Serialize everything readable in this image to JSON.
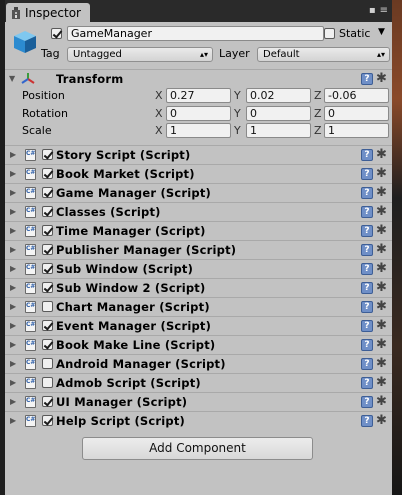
{
  "tab": {
    "title": "Inspector"
  },
  "header": {
    "object_name": "GameManager",
    "active": true,
    "static_label": "Static",
    "static_checked": false,
    "tag_label": "Tag",
    "tag_value": "Untagged",
    "layer_label": "Layer",
    "layer_value": "Default"
  },
  "transform": {
    "title": "Transform",
    "rows": [
      {
        "label": "Position",
        "x": "0.27",
        "y": "0.02",
        "z": "-0.06"
      },
      {
        "label": "Rotation",
        "x": "0",
        "y": "0",
        "z": "0"
      },
      {
        "label": "Scale",
        "x": "1",
        "y": "1",
        "z": "1"
      }
    ],
    "axes": {
      "x": "X",
      "y": "Y",
      "z": "Z"
    }
  },
  "components": [
    {
      "name": "Story Script (Script)",
      "enabled": true
    },
    {
      "name": "Book Market (Script)",
      "enabled": true
    },
    {
      "name": "Game Manager (Script)",
      "enabled": true
    },
    {
      "name": "Classes (Script)",
      "enabled": true
    },
    {
      "name": "Time Manager (Script)",
      "enabled": true
    },
    {
      "name": "Publisher Manager (Script)",
      "enabled": true
    },
    {
      "name": "Sub Window (Script)",
      "enabled": true
    },
    {
      "name": "Sub Window 2 (Script)",
      "enabled": true
    },
    {
      "name": "Chart Manager (Script)",
      "enabled": false
    },
    {
      "name": "Event Manager (Script)",
      "enabled": true
    },
    {
      "name": "Book Make Line (Script)",
      "enabled": true
    },
    {
      "name": "Android Manager (Script)",
      "enabled": false
    },
    {
      "name": "Admob Script (Script)",
      "enabled": false
    },
    {
      "name": "UI Manager (Script)",
      "enabled": true
    },
    {
      "name": "Help Script (Script)",
      "enabled": true
    }
  ],
  "add_component_label": "Add Component",
  "icons": {
    "tab": "inspector-icon",
    "object": "gameobject-cube-icon",
    "transform": "transform-axes-icon",
    "component": "csharp-script-icon",
    "help": "help-book-icon",
    "settings": "gear-icon"
  },
  "colors": {
    "panel": "#c2c2c2",
    "help": "#6f8fc7",
    "dark_chrome": "#2a2a2a"
  }
}
